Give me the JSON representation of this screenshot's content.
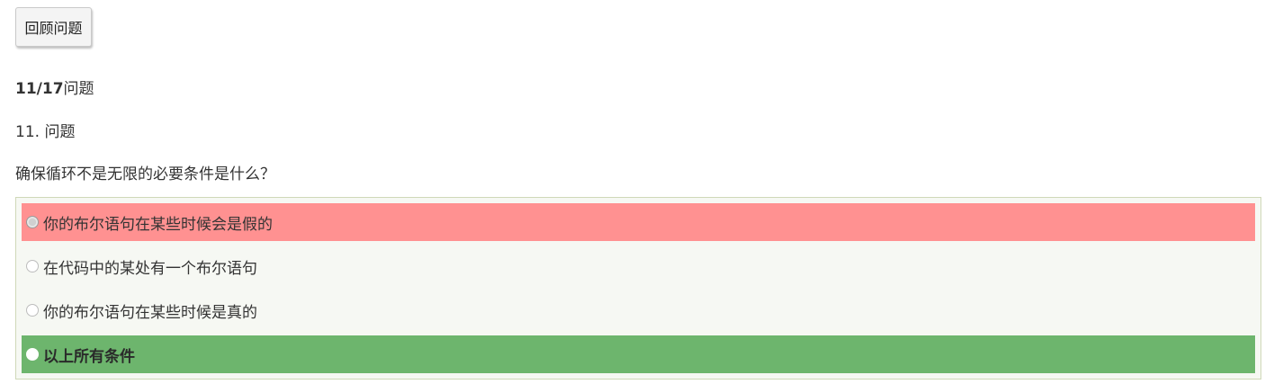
{
  "toolbar": {
    "review_label": "回顾问题"
  },
  "progress": {
    "count": "11/17",
    "suffix": "问题"
  },
  "question": {
    "number_label": "11. 问题",
    "text": "确保循环不是无限的必要条件是什么？"
  },
  "answers": [
    {
      "label": "你的布尔语句在某些时候会是假的",
      "state": "selected-wrong"
    },
    {
      "label": "在代码中的某处有一个布尔语句",
      "state": "none"
    },
    {
      "label": "你的布尔语句在某些时候是真的",
      "state": "none"
    },
    {
      "label": "以上所有条件",
      "state": "correct"
    }
  ],
  "colors": {
    "wrong": "#ff9191",
    "correct": "#6db56d",
    "panel_background": "#f6f8f3"
  }
}
